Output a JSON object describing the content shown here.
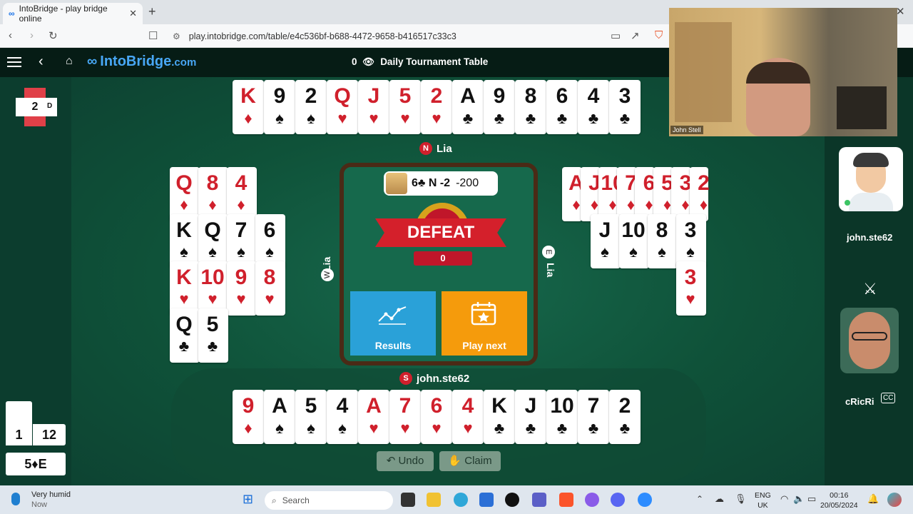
{
  "browser": {
    "tab_title": "IntoBridge - play bridge online",
    "url": "play.intobridge.com/table/e4c536bf-b688-4472-9658-b416517c33c3"
  },
  "app": {
    "logo_text": "IntoBridge",
    "logo_suffix": ".com",
    "spectators": "0",
    "table_title": "Daily Tournament Table"
  },
  "board": {
    "number": "2",
    "dealer": "D",
    "contract": "6♣ N -2",
    "score": "-200",
    "result": "DEFEAT",
    "result_points": "0",
    "results_label": "Results",
    "play_next_label": "Play next"
  },
  "seats": {
    "north": {
      "letter": "N",
      "name": "Lia"
    },
    "south": {
      "letter": "S",
      "name": "john.ste62"
    },
    "west": {
      "letter": "W",
      "name": "Lia"
    },
    "east": {
      "letter": "E",
      "name": "Lia"
    }
  },
  "hands": {
    "north": [
      [
        "K",
        "♦",
        "r"
      ],
      [
        "9",
        "♠",
        "b"
      ],
      [
        "2",
        "♠",
        "b"
      ],
      [
        "Q",
        "♥",
        "r"
      ],
      [
        "J",
        "♥",
        "r"
      ],
      [
        "5",
        "♥",
        "r"
      ],
      [
        "2",
        "♥",
        "r"
      ],
      [
        "A",
        "♣",
        "b"
      ],
      [
        "9",
        "♣",
        "b"
      ],
      [
        "8",
        "♣",
        "b"
      ],
      [
        "6",
        "♣",
        "b"
      ],
      [
        "4",
        "♣",
        "b"
      ],
      [
        "3",
        "♣",
        "b"
      ]
    ],
    "south": [
      [
        "9",
        "♦",
        "r"
      ],
      [
        "A",
        "♠",
        "b"
      ],
      [
        "5",
        "♠",
        "b"
      ],
      [
        "4",
        "♠",
        "b"
      ],
      [
        "A",
        "♥",
        "r"
      ],
      [
        "7",
        "♥",
        "r"
      ],
      [
        "6",
        "♥",
        "r"
      ],
      [
        "4",
        "♥",
        "r"
      ],
      [
        "K",
        "♣",
        "b"
      ],
      [
        "J",
        "♣",
        "b"
      ],
      [
        "10",
        "♣",
        "b"
      ],
      [
        "7",
        "♣",
        "b"
      ],
      [
        "2",
        "♣",
        "b"
      ]
    ],
    "west": {
      "diamonds": [
        "Q",
        "8",
        "4"
      ],
      "spades": [
        "K",
        "Q",
        "7",
        "6"
      ],
      "hearts": [
        "K",
        "10",
        "9",
        "8"
      ],
      "clubs": [
        "Q",
        "5"
      ]
    },
    "east": {
      "diamonds": [
        "A",
        "J",
        "10",
        "7",
        "6",
        "5",
        "3",
        "2"
      ],
      "spades": [
        "J",
        "10",
        "8",
        "3"
      ],
      "hearts": [
        "3"
      ]
    }
  },
  "tricks": {
    "ns": "1",
    "ew": "12"
  },
  "final_contract": "5♦E",
  "controls": {
    "undo": "Undo",
    "claim": "Claim"
  },
  "right_panel": {
    "player1": "john.ste62",
    "player2": "cRicRi",
    "badge": "CC"
  },
  "video": {
    "name": "John Stell"
  },
  "taskbar": {
    "weather": "Very humid",
    "weather_sub": "Now",
    "search_placeholder": "Search",
    "lang_top": "ENG",
    "lang_bottom": "UK",
    "time": "00:16",
    "date": "20/05/2024"
  }
}
